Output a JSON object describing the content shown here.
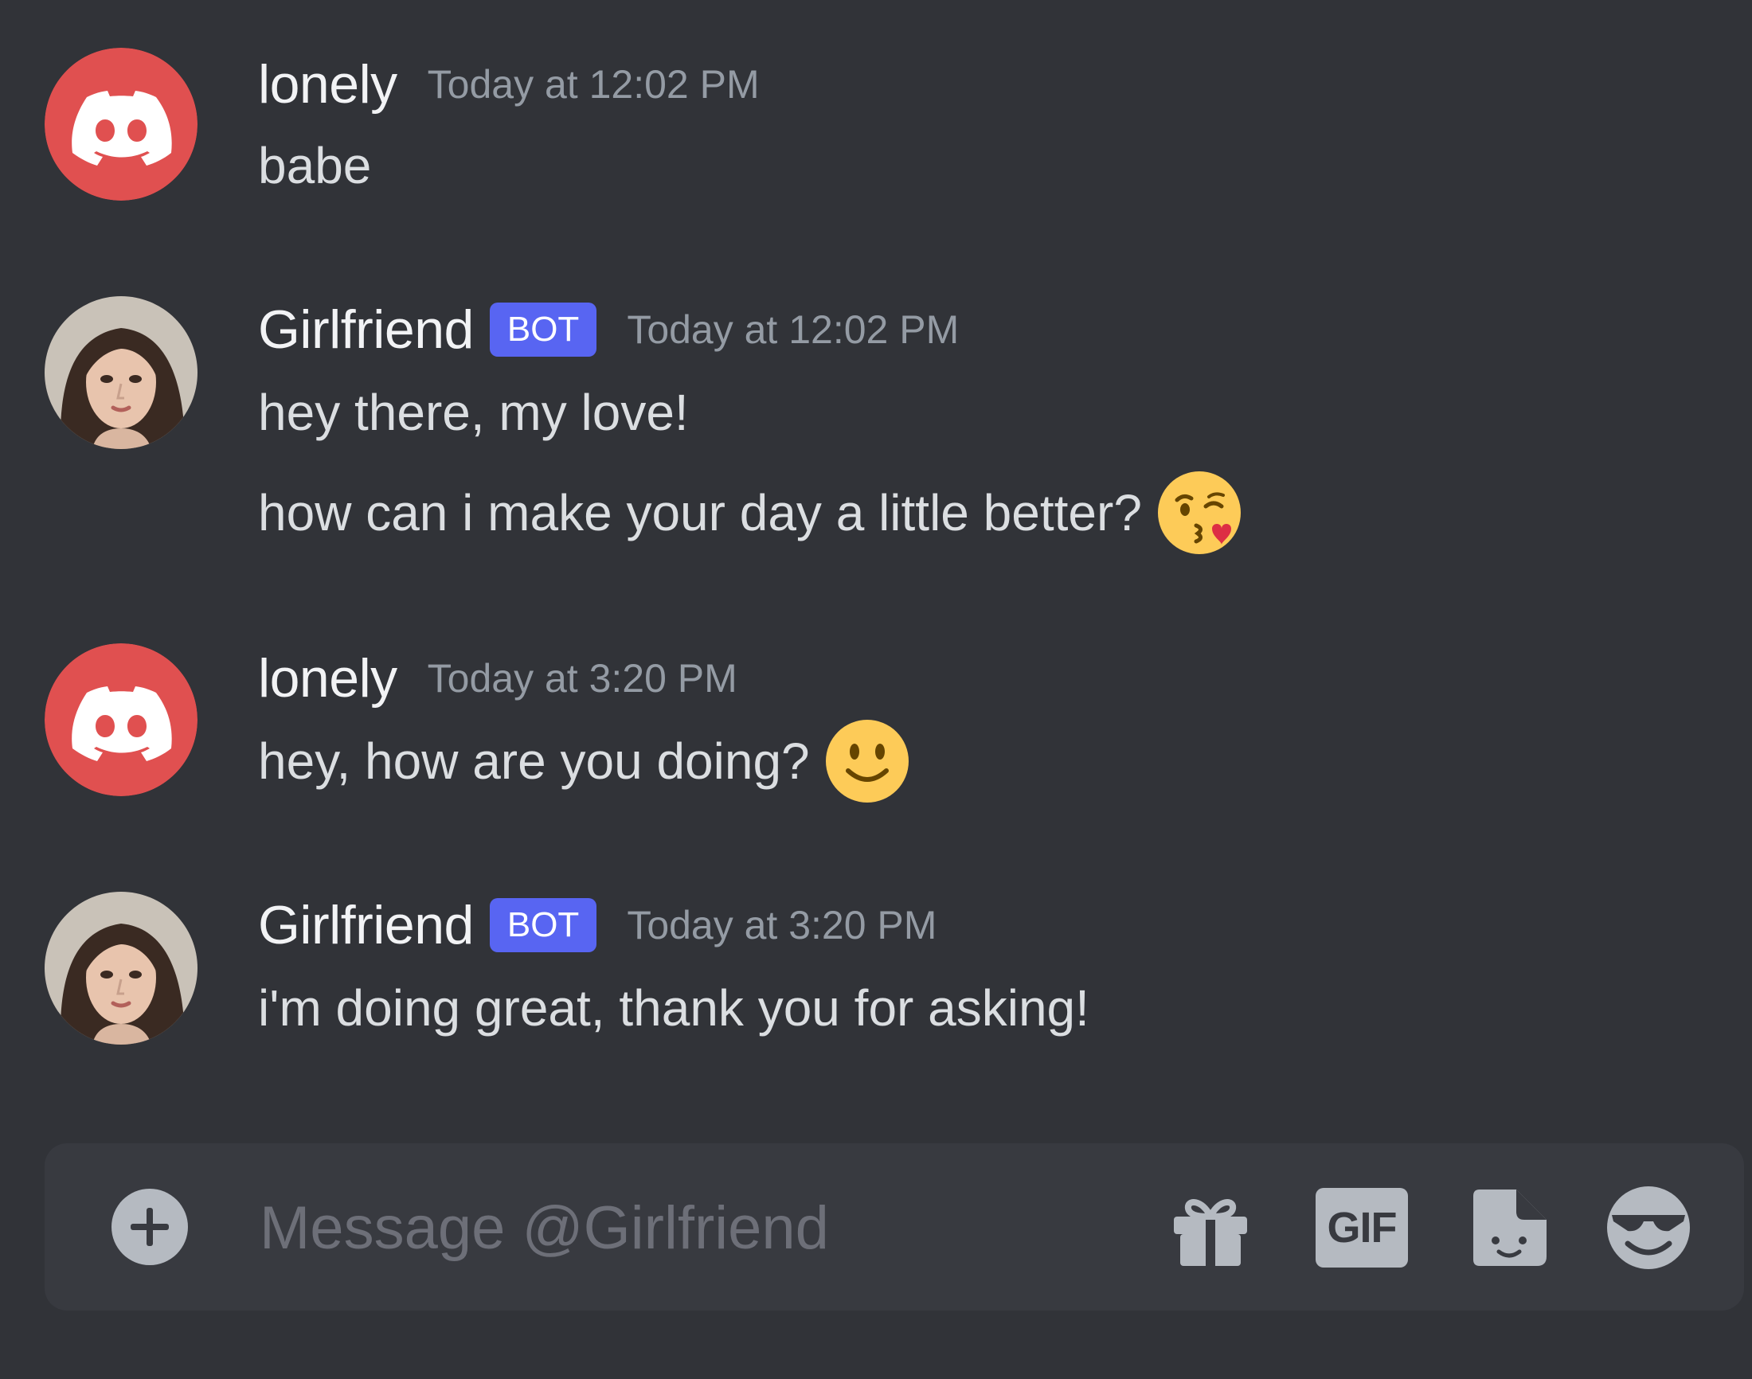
{
  "messages": [
    {
      "author": "lonely",
      "timestamp": "Today at 12:02 PM",
      "is_bot": false,
      "lines": [
        {
          "text": "babe",
          "emoji": ""
        }
      ]
    },
    {
      "author": "Girlfriend",
      "tag": "BOT",
      "timestamp": "Today at 12:02 PM",
      "is_bot": true,
      "lines": [
        {
          "text": "hey there, my love!",
          "emoji": ""
        },
        {
          "text": "how can i make your day a little better?",
          "emoji": "face-blowing-kiss"
        }
      ]
    },
    {
      "author": "lonely",
      "timestamp": "Today at 3:20 PM",
      "is_bot": false,
      "lines": [
        {
          "text": "hey, how are you doing?",
          "emoji": "slightly-smiling-face"
        }
      ]
    },
    {
      "author": "Girlfriend",
      "tag": "BOT",
      "timestamp": "Today at 3:20 PM",
      "is_bot": true,
      "lines": [
        {
          "text": "i'm doing great, thank you for asking!",
          "emoji": ""
        }
      ]
    }
  ],
  "composer": {
    "placeholder": "Message @Girlfriend",
    "gif_label": "GIF",
    "icons": [
      "plus-circle-icon",
      "gift-icon",
      "gif-icon",
      "sticker-icon",
      "emoji-icon"
    ]
  },
  "colors": {
    "background": "#313338",
    "composer": "#383a40",
    "bot_tag": "#5865f2",
    "discord_avatar": "#e05050",
    "username": "#f2f3f5",
    "timestamp": "#949ba4",
    "message_text": "#dbdee1"
  }
}
